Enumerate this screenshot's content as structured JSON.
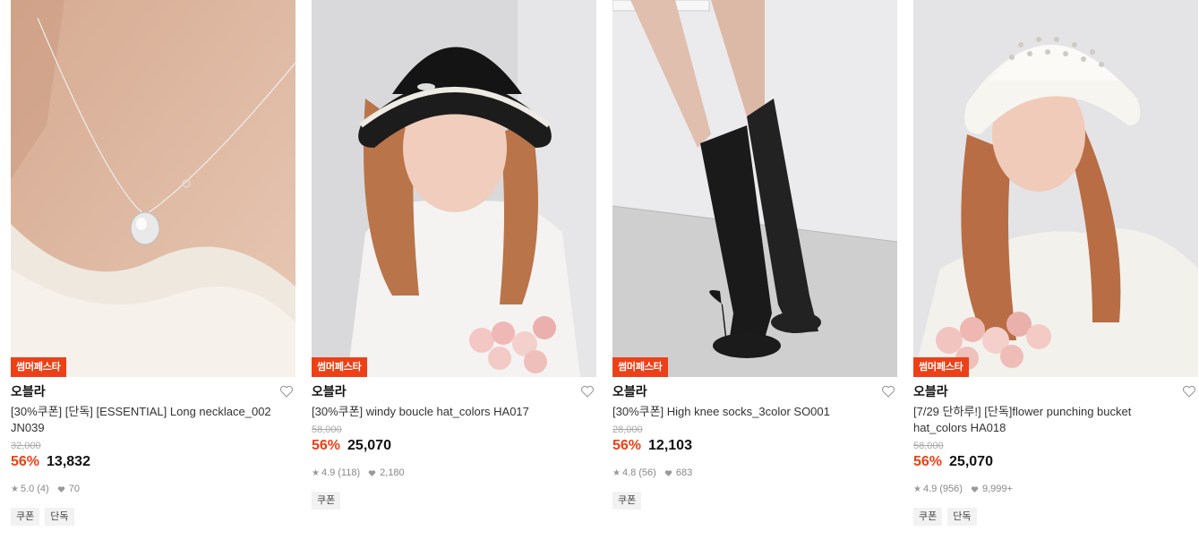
{
  "products": [
    {
      "festa": "썸머페스타",
      "brand": "오블라",
      "name": "[30%쿠폰] [단독] [ESSENTIAL] Long necklace_002 JN039",
      "original_price": "32,000",
      "discount": "56%",
      "price": "13,832",
      "rating": "5.0",
      "review_count": "(4)",
      "likes": "70",
      "tags": [
        "쿠폰",
        "단독"
      ]
    },
    {
      "festa": "썸머페스타",
      "brand": "오블라",
      "name": "[30%쿠폰] windy boucle hat_colors HA017",
      "original_price": "58,000",
      "discount": "56%",
      "price": "25,070",
      "rating": "4.9",
      "review_count": "(118)",
      "likes": "2,180",
      "tags": [
        "쿠폰"
      ]
    },
    {
      "festa": "썸머페스타",
      "brand": "오블라",
      "name": "[30%쿠폰] High knee socks_3color SO001",
      "original_price": "28,000",
      "discount": "56%",
      "price": "12,103",
      "rating": "4.8",
      "review_count": "(56)",
      "likes": "683",
      "tags": [
        "쿠폰"
      ]
    },
    {
      "festa": "썸머페스타",
      "brand": "오블라",
      "name": "[7/29 단하루!] [단독]flower punching bucket hat_colors HA018",
      "original_price": "58,000",
      "discount": "56%",
      "price": "25,070",
      "rating": "4.9",
      "review_count": "(956)",
      "likes": "9,999+",
      "tags": [
        "쿠폰",
        "단독"
      ]
    }
  ],
  "colors": {
    "accent": "#ee4016",
    "tag_bg": "#f2f2f2",
    "muted": "#888888"
  },
  "icons": {
    "wishlist": "heart-outline-icon",
    "rating": "star-icon",
    "likes": "heart-filled-icon"
  }
}
